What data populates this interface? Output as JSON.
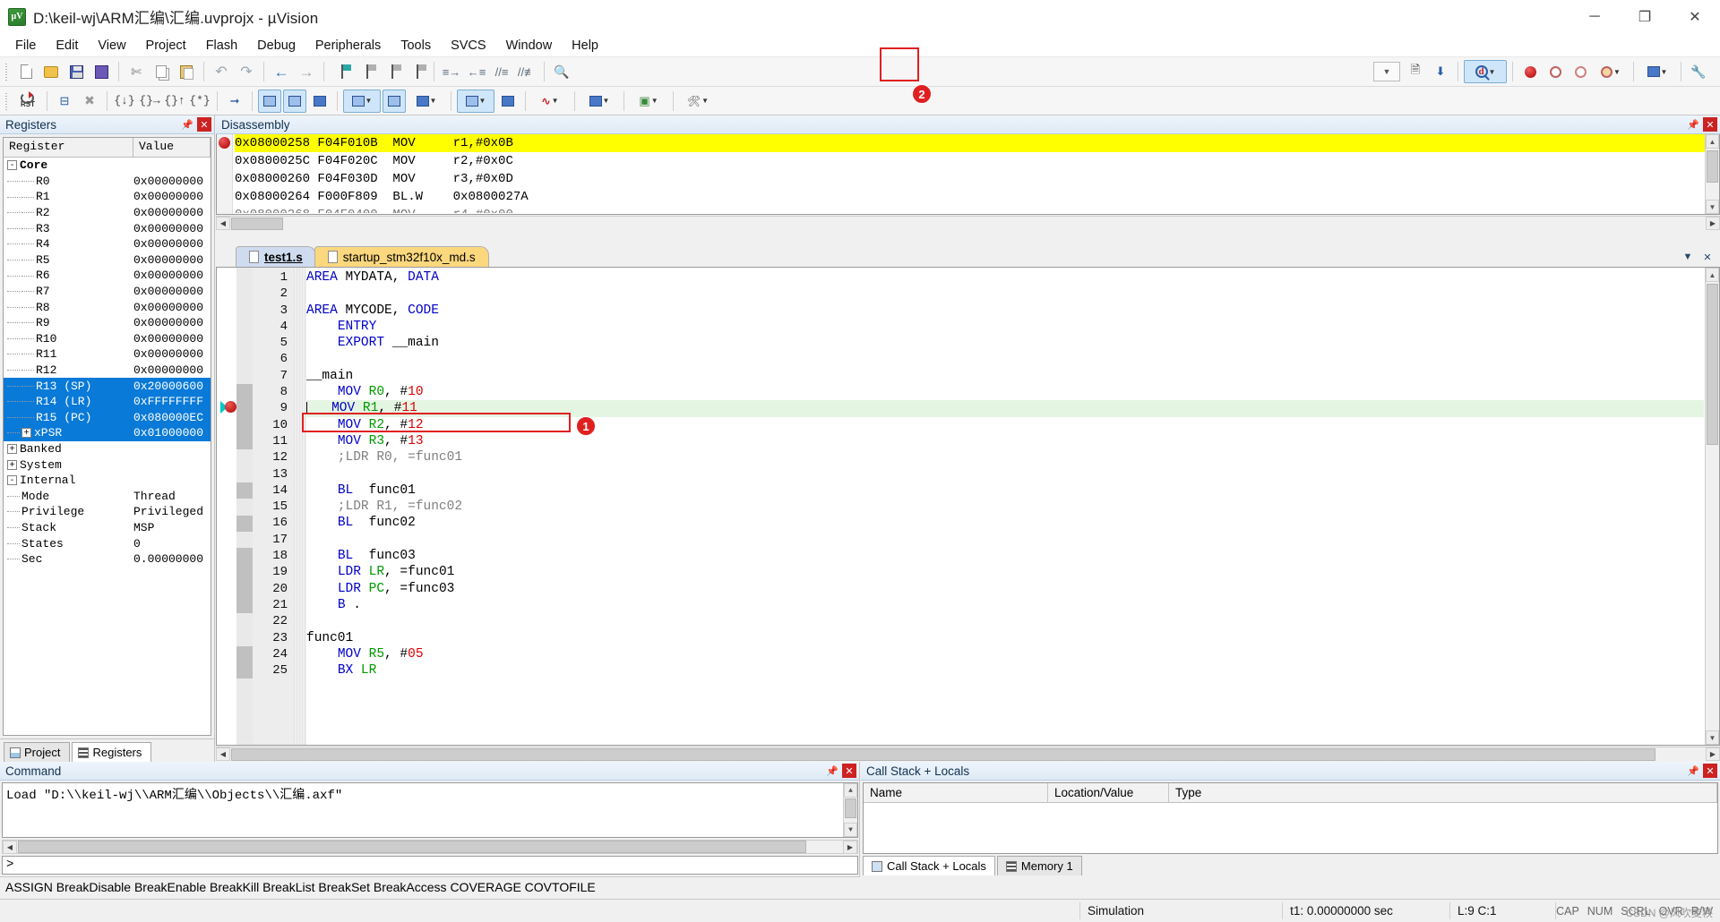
{
  "window": {
    "title": "D:\\keil-wj\\ARM汇编\\汇编.uvprojx - µVision",
    "logo_text": "µV",
    "minimize": "─",
    "maximize": "❐",
    "close": "✕"
  },
  "menu": [
    "File",
    "Edit",
    "View",
    "Project",
    "Flash",
    "Debug",
    "Peripherals",
    "Tools",
    "SVCS",
    "Window",
    "Help"
  ],
  "toolbar_row1": [
    {
      "name": "new-file-button",
      "icon": "new-file-icon"
    },
    {
      "name": "open-file-button",
      "icon": "open-folder-icon"
    },
    {
      "name": "save-button",
      "icon": "save-icon"
    },
    {
      "name": "save-all-button",
      "icon": "save-all-icon"
    },
    {
      "name": "cut-button",
      "icon": "scissors-icon"
    },
    {
      "name": "copy-button",
      "icon": "copy-icon"
    },
    {
      "name": "paste-button",
      "icon": "paste-icon"
    },
    {
      "name": "undo-button",
      "icon": "undo-icon"
    },
    {
      "name": "redo-button",
      "icon": "redo-icon"
    },
    {
      "name": "navigate-back-button",
      "icon": "arrow-left-icon"
    },
    {
      "name": "navigate-forward-button",
      "icon": "arrow-right-icon"
    },
    {
      "name": "insert-bookmark-button",
      "icon": "bookmark-flag-icon"
    },
    {
      "name": "prev-bookmark-button",
      "icon": "bookmark-prev-icon"
    },
    {
      "name": "next-bookmark-button",
      "icon": "bookmark-next-icon"
    },
    {
      "name": "clear-bookmarks-button",
      "icon": "bookmark-clear-icon"
    },
    {
      "name": "indent-button",
      "icon": "indent-right-icon"
    },
    {
      "name": "outdent-button",
      "icon": "indent-left-icon"
    },
    {
      "name": "comment-button",
      "icon": "comment-lines-icon"
    },
    {
      "name": "uncomment-button",
      "icon": "uncomment-lines-icon"
    },
    {
      "name": "find-in-files-button",
      "icon": "find-in-files-icon"
    }
  ],
  "toolbar_row1_right": [
    {
      "name": "target-options-dropdown",
      "icon": "chevron-down-icon"
    },
    {
      "name": "debug-settings-button",
      "icon": "debug-settings-icon"
    },
    {
      "name": "configure-target-button",
      "icon": "configure-target-icon"
    },
    {
      "name": "start-stop-debug-button",
      "icon": "debug-magnifier-icon",
      "active": true
    },
    {
      "name": "insert-remove-breakpoint-button",
      "icon": "breakpoint-dot-icon"
    },
    {
      "name": "enable-disable-breakpoint-button",
      "icon": "breakpoint-ring-icon"
    },
    {
      "name": "disable-all-breakpoints-button",
      "icon": "breakpoint-disable-icon"
    },
    {
      "name": "kill-all-breakpoints-button",
      "icon": "breakpoint-kill-icon"
    },
    {
      "name": "show-next-statement-button",
      "icon": "next-statement-icon"
    },
    {
      "name": "debug-settings-wrench-button",
      "icon": "wrench-icon"
    }
  ],
  "toolbar_row2": [
    {
      "name": "reset-cpu-button",
      "icon": "reset-icon",
      "label": "RST"
    },
    {
      "name": "run-button",
      "icon": "run-icon"
    },
    {
      "name": "stop-button",
      "icon": "stop-icon"
    },
    {
      "name": "step-button",
      "icon": "step-into-icon"
    },
    {
      "name": "step-over-button",
      "icon": "step-over-icon"
    },
    {
      "name": "step-out-button",
      "icon": "step-out-icon"
    },
    {
      "name": "run-to-cursor-button",
      "icon": "run-to-cursor-icon"
    },
    {
      "name": "show-next-statement-button2",
      "icon": "next-statement-arrow-icon"
    },
    {
      "name": "command-window-button",
      "icon": "command-window-icon"
    },
    {
      "name": "disassembly-window-button",
      "icon": "disassembly-window-icon"
    },
    {
      "name": "symbols-window-button",
      "icon": "symbols-window-icon"
    },
    {
      "name": "registers-window-button",
      "icon": "registers-window-icon"
    },
    {
      "name": "call-stack-window-button",
      "icon": "call-stack-window-icon"
    },
    {
      "name": "watch-window-button",
      "icon": "watch-window-icon"
    },
    {
      "name": "memory-window-button",
      "icon": "memory-window-icon"
    },
    {
      "name": "serial-window-button",
      "icon": "serial-window-icon"
    },
    {
      "name": "analysis-window-button",
      "icon": "analysis-window-icon"
    },
    {
      "name": "trace-window-button",
      "icon": "trace-window-icon"
    },
    {
      "name": "system-viewer-button",
      "icon": "system-viewer-icon"
    },
    {
      "name": "toolbox-button",
      "icon": "toolbox-icon"
    }
  ],
  "annotations": [
    {
      "name": "annotation-1",
      "label": "1"
    },
    {
      "name": "annotation-2",
      "label": "2"
    }
  ],
  "registers_panel": {
    "title": "Registers",
    "columns": [
      "Register",
      "Value"
    ],
    "rows": [
      {
        "name": "Core",
        "value": "",
        "indent": 0,
        "toggle": "-",
        "bold": true,
        "selected": false
      },
      {
        "name": "R0",
        "value": "0x00000000",
        "indent": 2,
        "toggle": "",
        "bold": false,
        "selected": false
      },
      {
        "name": "R1",
        "value": "0x00000000",
        "indent": 2,
        "toggle": "",
        "bold": false,
        "selected": false
      },
      {
        "name": "R2",
        "value": "0x00000000",
        "indent": 2,
        "toggle": "",
        "bold": false,
        "selected": false
      },
      {
        "name": "R3",
        "value": "0x00000000",
        "indent": 2,
        "toggle": "",
        "bold": false,
        "selected": false
      },
      {
        "name": "R4",
        "value": "0x00000000",
        "indent": 2,
        "toggle": "",
        "bold": false,
        "selected": false
      },
      {
        "name": "R5",
        "value": "0x00000000",
        "indent": 2,
        "toggle": "",
        "bold": false,
        "selected": false
      },
      {
        "name": "R6",
        "value": "0x00000000",
        "indent": 2,
        "toggle": "",
        "bold": false,
        "selected": false
      },
      {
        "name": "R7",
        "value": "0x00000000",
        "indent": 2,
        "toggle": "",
        "bold": false,
        "selected": false
      },
      {
        "name": "R8",
        "value": "0x00000000",
        "indent": 2,
        "toggle": "",
        "bold": false,
        "selected": false
      },
      {
        "name": "R9",
        "value": "0x00000000",
        "indent": 2,
        "toggle": "",
        "bold": false,
        "selected": false
      },
      {
        "name": "R10",
        "value": "0x00000000",
        "indent": 2,
        "toggle": "",
        "bold": false,
        "selected": false
      },
      {
        "name": "R11",
        "value": "0x00000000",
        "indent": 2,
        "toggle": "",
        "bold": false,
        "selected": false
      },
      {
        "name": "R12",
        "value": "0x00000000",
        "indent": 2,
        "toggle": "",
        "bold": false,
        "selected": false
      },
      {
        "name": "R13 (SP)",
        "value": "0x20000600",
        "indent": 2,
        "toggle": "",
        "bold": false,
        "selected": true
      },
      {
        "name": "R14 (LR)",
        "value": "0xFFFFFFFF",
        "indent": 2,
        "toggle": "",
        "bold": false,
        "selected": true
      },
      {
        "name": "R15 (PC)",
        "value": "0x080000EC",
        "indent": 2,
        "toggle": "",
        "bold": false,
        "selected": true
      },
      {
        "name": "xPSR",
        "value": "0x01000000",
        "indent": 1,
        "toggle": "+",
        "bold": false,
        "selected": true
      },
      {
        "name": "Banked",
        "value": "",
        "indent": 0,
        "toggle": "+",
        "bold": false,
        "selected": false
      },
      {
        "name": "System",
        "value": "",
        "indent": 0,
        "toggle": "+",
        "bold": false,
        "selected": false
      },
      {
        "name": "Internal",
        "value": "",
        "indent": 0,
        "toggle": "-",
        "bold": false,
        "selected": false
      },
      {
        "name": "Mode",
        "value": "Thread",
        "indent": 1,
        "toggle": "",
        "bold": false,
        "selected": false
      },
      {
        "name": "Privilege",
        "value": "Privileged",
        "indent": 1,
        "toggle": "",
        "bold": false,
        "selected": false
      },
      {
        "name": "Stack",
        "value": "MSP",
        "indent": 1,
        "toggle": "",
        "bold": false,
        "selected": false
      },
      {
        "name": "States",
        "value": "0",
        "indent": 1,
        "toggle": "",
        "bold": false,
        "selected": false
      },
      {
        "name": "Sec",
        "value": "0.00000000",
        "indent": 1,
        "toggle": "",
        "bold": false,
        "selected": false
      }
    ],
    "tabs": [
      {
        "label": "Project",
        "selected": false,
        "icon": "project-icon"
      },
      {
        "label": "Registers",
        "selected": true,
        "icon": "registers-icon"
      }
    ]
  },
  "disassembly": {
    "title": "Disassembly",
    "lines": [
      {
        "addr": "0x08000258",
        "opcode": "F04F010B",
        "mnem": "MOV",
        "operands": "r1,#0x0B",
        "current": true,
        "breakpoint": true
      },
      {
        "addr": "0x0800025C",
        "opcode": "F04F020C",
        "mnem": "MOV",
        "operands": "r2,#0x0C",
        "current": false,
        "breakpoint": false
      },
      {
        "addr": "0x08000260",
        "opcode": "F04F030D",
        "mnem": "MOV",
        "operands": "r3,#0x0D",
        "current": false,
        "breakpoint": false
      },
      {
        "addr": "0x08000264",
        "opcode": "F000F809",
        "mnem": "BL.W",
        "operands": "0x0800027A",
        "current": false,
        "breakpoint": false
      }
    ]
  },
  "editor": {
    "tabs": [
      {
        "label": "test1.s",
        "selected": true
      },
      {
        "label": "startup_stm32f10x_md.s",
        "selected": false
      }
    ],
    "lines": [
      {
        "n": 1,
        "text": "AREA MYDATA, DATA",
        "indent": 0,
        "cur": false,
        "mark": false
      },
      {
        "n": 2,
        "text": "",
        "indent": 0,
        "cur": false,
        "mark": false
      },
      {
        "n": 3,
        "text": "AREA MYCODE, CODE",
        "indent": 0,
        "cur": false,
        "mark": false
      },
      {
        "n": 4,
        "text": "ENTRY",
        "indent": 1,
        "cur": false,
        "mark": false
      },
      {
        "n": 5,
        "text": "EXPORT __main",
        "indent": 1,
        "cur": false,
        "mark": false
      },
      {
        "n": 6,
        "text": "",
        "indent": 0,
        "cur": false,
        "mark": false
      },
      {
        "n": 7,
        "text": "__main",
        "indent": 0,
        "cur": false,
        "mark": false
      },
      {
        "n": 8,
        "text": "MOV R0, #10",
        "indent": 1,
        "cur": false,
        "mark": true
      },
      {
        "n": 9,
        "text": "MOV R1, #11",
        "indent": 1,
        "cur": true,
        "mark": true
      },
      {
        "n": 10,
        "text": "MOV R2, #12",
        "indent": 1,
        "cur": false,
        "mark": true
      },
      {
        "n": 11,
        "text": "MOV R3, #13",
        "indent": 1,
        "cur": false,
        "mark": true
      },
      {
        "n": 12,
        "text": ";LDR R0, =func01",
        "indent": 1,
        "cur": false,
        "mark": false
      },
      {
        "n": 13,
        "text": "",
        "indent": 0,
        "cur": false,
        "mark": false
      },
      {
        "n": 14,
        "text": "BL  func01",
        "indent": 1,
        "cur": false,
        "mark": true
      },
      {
        "n": 15,
        "text": ";LDR R1, =func02",
        "indent": 1,
        "cur": false,
        "mark": false
      },
      {
        "n": 16,
        "text": "BL  func02",
        "indent": 1,
        "cur": false,
        "mark": true
      },
      {
        "n": 17,
        "text": "",
        "indent": 0,
        "cur": false,
        "mark": false
      },
      {
        "n": 18,
        "text": "BL  func03",
        "indent": 1,
        "cur": false,
        "mark": true
      },
      {
        "n": 19,
        "text": "LDR LR, =func01",
        "indent": 1,
        "cur": false,
        "mark": true
      },
      {
        "n": 20,
        "text": "LDR PC, =func03",
        "indent": 1,
        "cur": false,
        "mark": true
      },
      {
        "n": 21,
        "text": "B .",
        "indent": 1,
        "cur": false,
        "mark": true
      },
      {
        "n": 22,
        "text": "",
        "indent": 0,
        "cur": false,
        "mark": false
      },
      {
        "n": 23,
        "text": "func01",
        "indent": 0,
        "cur": false,
        "mark": false
      },
      {
        "n": 24,
        "text": "MOV R5, #05",
        "indent": 1,
        "cur": false,
        "mark": true
      },
      {
        "n": 25,
        "text": "BX LR",
        "indent": 1,
        "cur": false,
        "mark": true
      }
    ]
  },
  "command_panel": {
    "title": "Command",
    "output": "Load \"D:\\\\keil-wj\\\\ARM汇编\\\\Objects\\\\汇编.axf\"",
    "prompt": ">",
    "input_value": "",
    "command_list": "ASSIGN BreakDisable BreakEnable BreakKill BreakList BreakSet BreakAccess COVERAGE COVTOFILE"
  },
  "call_stack_panel": {
    "title": "Call Stack + Locals",
    "columns": [
      "Name",
      "Location/Value",
      "Type"
    ],
    "rows": [],
    "tabs": [
      {
        "label": "Call Stack + Locals",
        "selected": true,
        "icon": "call-stack-icon"
      },
      {
        "label": "Memory 1",
        "selected": false,
        "icon": "memory-icon"
      }
    ]
  },
  "statusbar": {
    "left": "",
    "simulation": "Simulation",
    "t1": "t1: 0.00000000 sec",
    "position": "L:9 C:1",
    "flags": [
      "CAP",
      "NUM",
      "SCRL",
      "OVR",
      "R/W"
    ],
    "watermark": "CSDN @风吹麦秧"
  }
}
